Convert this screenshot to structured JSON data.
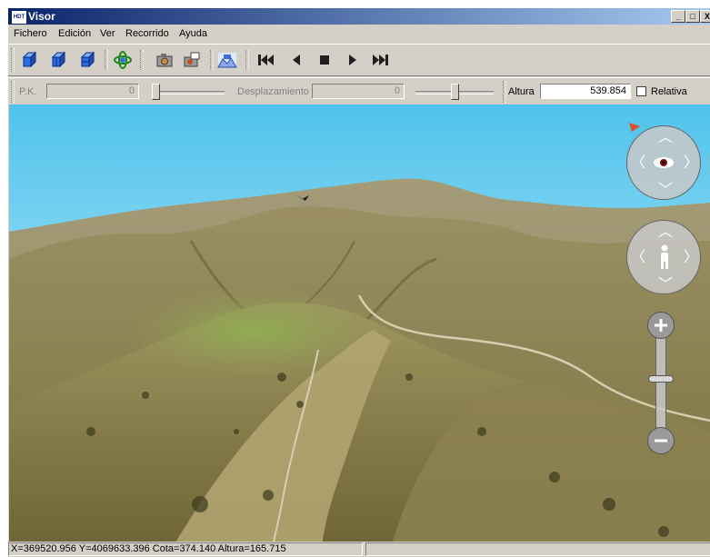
{
  "window": {
    "title": "Visor",
    "app_icon_text": "HDT",
    "controls": {
      "minimize": "_",
      "maximize": "□",
      "close": "X"
    }
  },
  "menu": {
    "items": [
      "Fichero",
      "Edición",
      "Ver",
      "Recorrido",
      "Ayuda"
    ]
  },
  "toolbar": {
    "buttons": [
      {
        "name": "view-cube-1",
        "icon": "blue-cube-icon"
      },
      {
        "name": "view-cube-2",
        "icon": "blue-cube-icon"
      },
      {
        "name": "view-cube-3",
        "icon": "blue-cube-icon"
      },
      {
        "name": "orbit",
        "icon": "orbit-icon"
      },
      {
        "name": "capture",
        "icon": "camera-icon"
      },
      {
        "name": "record",
        "icon": "camera-record-icon"
      },
      {
        "name": "terrain",
        "icon": "terrain-icon"
      },
      {
        "name": "first",
        "icon": "skip-first-icon"
      },
      {
        "name": "prev",
        "icon": "play-back-icon"
      },
      {
        "name": "stop",
        "icon": "stop-icon"
      },
      {
        "name": "play",
        "icon": "play-icon"
      },
      {
        "name": "last",
        "icon": "skip-last-icon"
      }
    ]
  },
  "params": {
    "pk_label": "P.K.",
    "pk_value": "0",
    "desplazamiento_label": "Desplazamiento",
    "desplazamiento_value": "0",
    "altura_label": "Altura",
    "altura_value": "539.854",
    "relativa_label": "Relativa",
    "relativa_checked": false
  },
  "status": {
    "coords": "X=369520.956 Y=4069633.396 Cota=374.140 Altura=165.715",
    "secondary": ""
  },
  "colors": {
    "titlebar_start": "#0a246a",
    "titlebar_end": "#a6caf0",
    "chrome": "#d4d0c8",
    "sky_top": "#5ec8ee",
    "terrain": "#8f8658"
  }
}
